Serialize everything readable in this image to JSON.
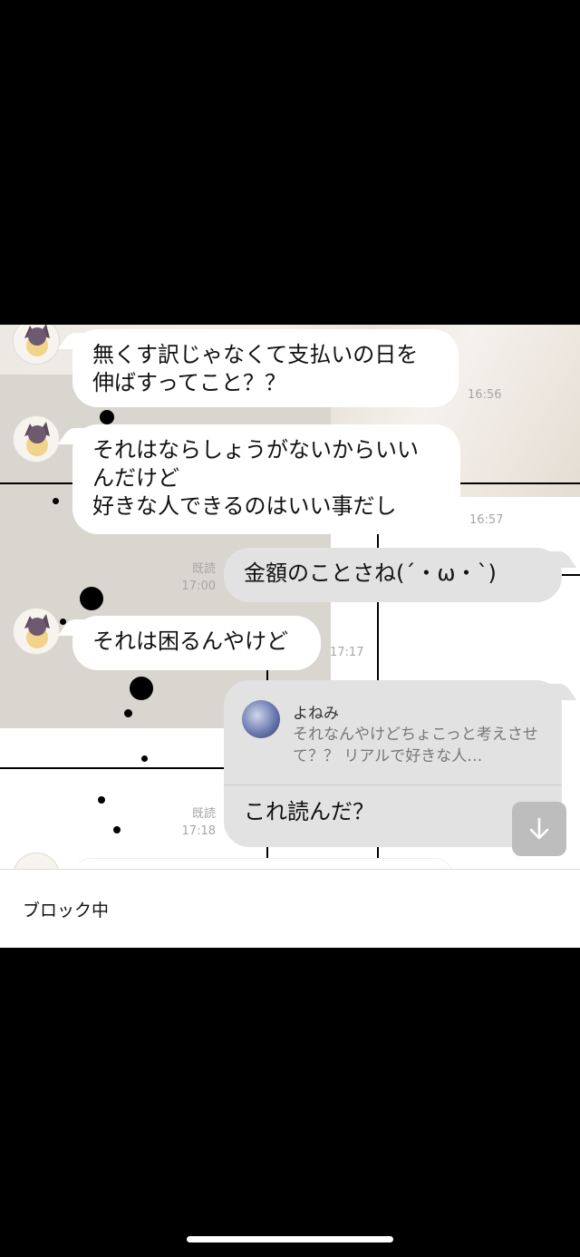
{
  "messages": [
    {
      "text": "無くす訳じゃなくて支払いの日を\n伸ばすってこと？？",
      "time": "16:56"
    },
    {
      "text": "それはならしょうがないからいい\nんだけど\n好きな人できるのはいい事だし",
      "time": "16:57"
    },
    {
      "text": "金額のことさね(´・ω・`)",
      "read": "既読",
      "time": "17:00"
    },
    {
      "text": "それは困るんやけど",
      "time": "17:17"
    }
  ],
  "reply": {
    "quoted_name": "よねみ",
    "quoted_text": "それなんやけどちょこっと考えさせて？？ リアルで好きな人…",
    "text": "これ読んだ？",
    "read": "既読",
    "time": "17:18"
  },
  "footer": {
    "label": "ブロック中"
  },
  "icons": {
    "scroll": "arrow-down-icon"
  }
}
